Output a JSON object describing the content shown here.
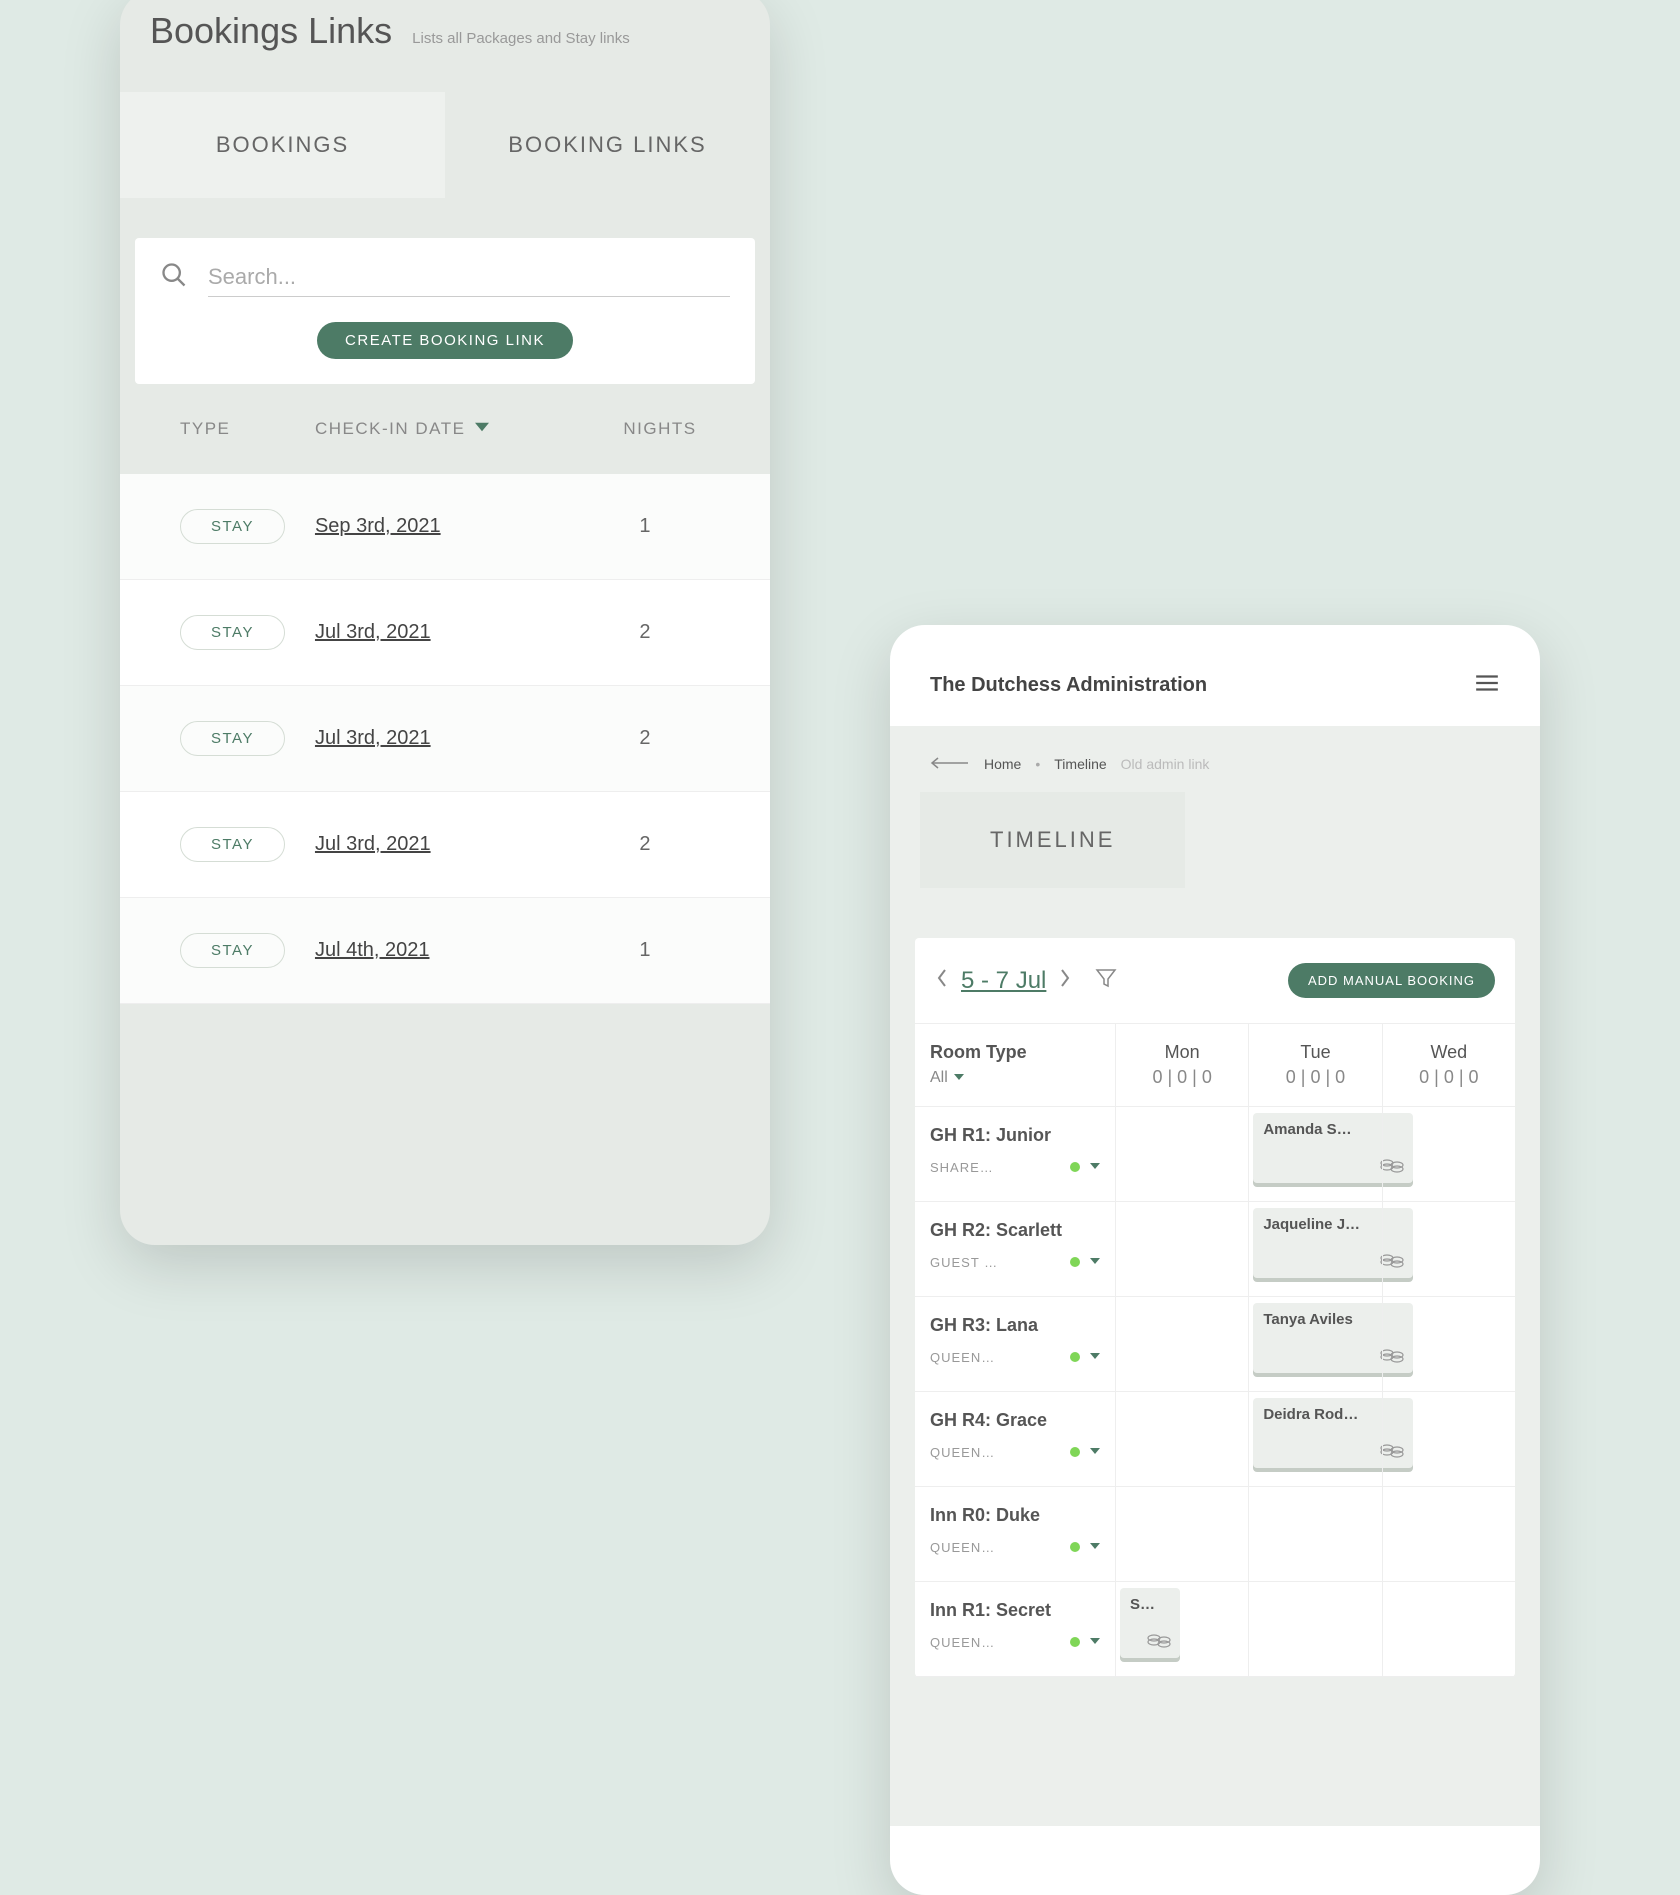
{
  "left": {
    "title": "Bookings Links",
    "subtitle": "Lists all Packages and Stay links",
    "tabs": {
      "bookings": "BOOKINGS",
      "booking_links": "BOOKING LINKS"
    },
    "search_placeholder": "Search...",
    "create_label": "CREATE BOOKING LINK",
    "cols": {
      "type": "TYPE",
      "checkin": "CHECK-IN DATE",
      "nights": "NIGHTS"
    },
    "rows": [
      {
        "type": "STAY",
        "date": "Sep 3rd, 2021",
        "nights": "1"
      },
      {
        "type": "STAY",
        "date": "Jul 3rd, 2021",
        "nights": "2"
      },
      {
        "type": "STAY",
        "date": "Jul 3rd, 2021",
        "nights": "2"
      },
      {
        "type": "STAY",
        "date": "Jul 3rd, 2021",
        "nights": "2"
      },
      {
        "type": "STAY",
        "date": "Jul 4th, 2021",
        "nights": "1"
      }
    ]
  },
  "right": {
    "app_title": "The Dutchess Administration",
    "crumbs": {
      "home": "Home",
      "timeline": "Timeline",
      "old": "Old admin link"
    },
    "tab": "TIMELINE",
    "date_range": "5 - 7 Jul",
    "add_label": "ADD MANUAL BOOKING",
    "room_type_label": "Room Type",
    "room_type_filter": "All",
    "days": [
      {
        "name": "Mon",
        "count": "0 | 0 | 0"
      },
      {
        "name": "Tue",
        "count": "0 | 0 | 0"
      },
      {
        "name": "Wed",
        "count": "0 | 0 | 0"
      }
    ],
    "rooms": [
      {
        "name": "GH R1: Junior",
        "sub": "SHARE…",
        "booking": {
          "guest": "Amanda S…",
          "col": 1
        }
      },
      {
        "name": "GH R2: Scarlett",
        "sub": "GUEST …",
        "booking": {
          "guest": "Jaqueline J…",
          "col": 1
        }
      },
      {
        "name": "GH R3: Lana",
        "sub": "QUEEN…",
        "booking": {
          "guest": "Tanya Aviles",
          "col": 1
        }
      },
      {
        "name": "GH R4: Grace",
        "sub": "QUEEN…",
        "booking": {
          "guest": "Deidra Rod…",
          "col": 1
        }
      },
      {
        "name": "Inn R0: Duke",
        "sub": "QUEEN…"
      },
      {
        "name": "Inn R1: Secret",
        "sub": "QUEEN…",
        "booking": {
          "guest": "S…",
          "col": 0,
          "narrow": true
        }
      }
    ]
  }
}
